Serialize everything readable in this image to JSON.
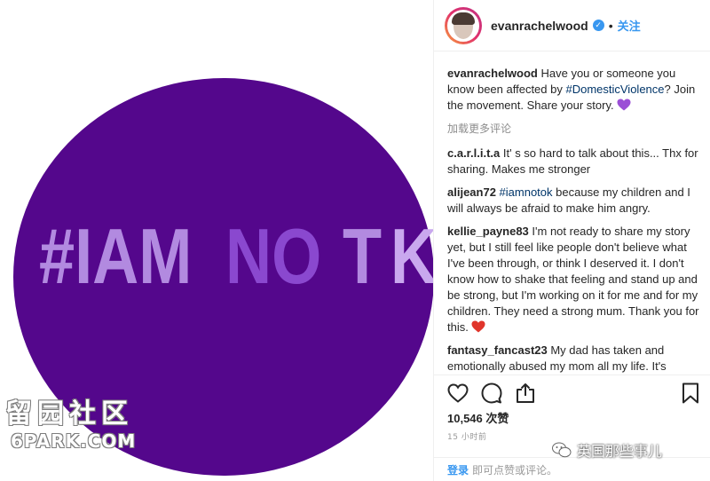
{
  "post_image": {
    "hashtag_parts": [
      "#IAM",
      "NO",
      "T",
      "K"
    ],
    "colors": {
      "circle": "#54078c",
      "text": "#b28ae0",
      "overlap": "#8a48cf"
    }
  },
  "watermarks": {
    "left_cn": "留园社区",
    "left_en": "6PARK.COM",
    "right_text": "英国那些事儿"
  },
  "header": {
    "username": "evanrachelwood",
    "separator": "•",
    "follow_label": "关注"
  },
  "caption": {
    "user": "evanrachelwood",
    "text_before": " Have you or someone you know been affected by ",
    "tag": "#DomesticViolence",
    "text_after": "? Join the movement. Share your story. "
  },
  "load_more_label": "加载更多评论",
  "comments": [
    {
      "user": "c.a.r.l.i.t.a",
      "text": " It' s so hard to talk about this... Thx for sharing. Makes me stronger"
    },
    {
      "user": "alijean72",
      "tag": " #iamnotok",
      "text": " because my children and I will always be afraid to make him angry."
    },
    {
      "user": "kellie_payne83",
      "text": " I'm not ready to share my story yet, but I still feel like people don't believe what I've been through, or think I deserved it. I don't know how to shake that feeling and stand up and be strong, but I'm working on it for me and for my children. They need a strong mum. Thank you for this. "
    },
    {
      "user": "fantasy_fancast23",
      "text": " My dad has taken and emotionally abused my mom all my life. It's"
    }
  ],
  "actions": {
    "likes_count": "10,546",
    "likes_unit": "次赞",
    "timestamp": "15 小时前",
    "login_label": "登录",
    "login_suffix": "即可点赞或评论。"
  },
  "icons": [
    "heart-icon",
    "comment-icon",
    "share-icon",
    "bookmark-icon",
    "verified-icon",
    "purple-heart-icon",
    "red-heart-icon"
  ]
}
